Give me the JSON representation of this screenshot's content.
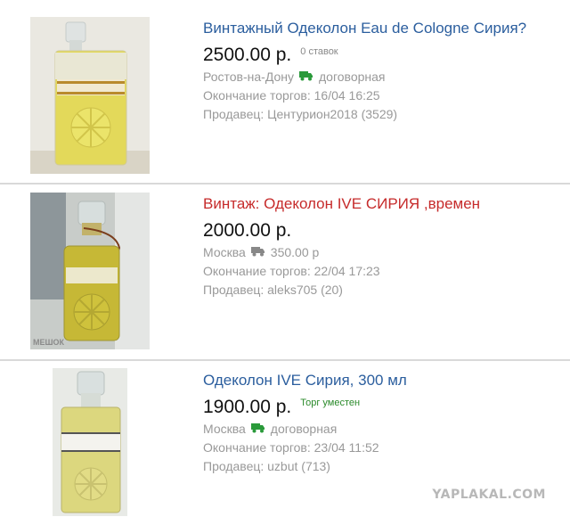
{
  "listings": [
    {
      "title": "Винтажный Одеколон Eau de Cologne Сирия?",
      "price": "2500.00 р.",
      "badge": "0 ставок",
      "city": "Ростов-на-Дону",
      "delivery": "договорная",
      "end": "Окончание торгов: 16/04 16:25",
      "seller": "Продавец: Центурион2018 (3529)"
    },
    {
      "title": "Винтаж: Одеколон IVE СИРИЯ ,времен",
      "price": "2000.00 р.",
      "city": "Москва",
      "delivery": "350.00 р",
      "end": "Окончание торгов: 22/04 17:23",
      "seller": "Продавец: aleks705 (20)",
      "image_watermark": "МЕШОК"
    },
    {
      "title": "Одеколон IVE Сирия, 300 мл",
      "price": "1900.00 р.",
      "badge": "Торг уместен",
      "city": "Москва",
      "delivery": "договорная",
      "end": "Окончание торгов: 23/04 11:52",
      "seller": "Продавец: uzbut (713)"
    }
  ],
  "watermark": "YAPLAKAL.COM",
  "colors": {
    "title_link": "#2b5e9e",
    "title_highlight": "#c62b2b",
    "truck_green": "#2a9a3a",
    "truck_gray": "#888888"
  },
  "icons": [
    "truck-icon"
  ]
}
